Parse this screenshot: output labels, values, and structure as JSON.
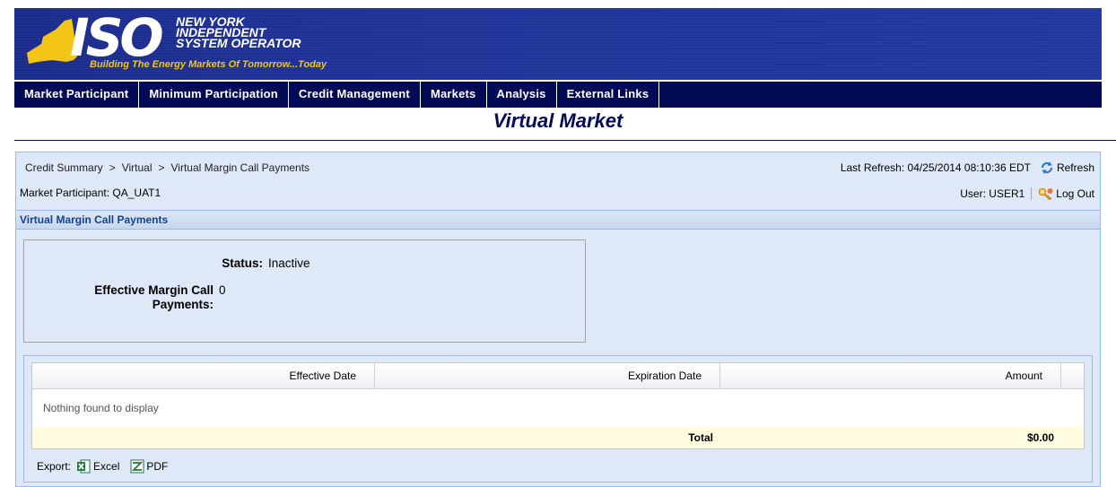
{
  "header": {
    "logo_text": "ISO",
    "org_name_lines": [
      "NEW YORK",
      "INDEPENDENT",
      "SYSTEM OPERATOR"
    ],
    "tagline": "Building The Energy Markets Of Tomorrow...Today",
    "colors": {
      "banner": "#1f3399",
      "nav": "#000a55",
      "tagline": "#f2c517",
      "state_shape": "#f2c517"
    }
  },
  "nav": {
    "items": [
      {
        "label": "Market Participant"
      },
      {
        "label": "Minimum Participation"
      },
      {
        "label": "Credit Management"
      },
      {
        "label": "Markets"
      },
      {
        "label": "Analysis"
      },
      {
        "label": "External Links"
      }
    ]
  },
  "page": {
    "title": "Virtual Market"
  },
  "breadcrumb": {
    "items": [
      {
        "label": "Credit Summary"
      },
      {
        "label": "Virtual"
      },
      {
        "label": "Virtual Margin Call Payments"
      }
    ],
    "separator": ">"
  },
  "participant": {
    "label": "Market Participant:",
    "value": "QA_UAT1"
  },
  "refresh": {
    "label": "Last Refresh:",
    "timestamp": "04/25/2014 08:10:36 EDT",
    "button_label": "Refresh",
    "icon": "refresh-icon"
  },
  "user": {
    "label": "User:",
    "value": "USER1",
    "logout_label": "Log Out",
    "icon": "logout-key-icon"
  },
  "section": {
    "title": "Virtual Margin Call Payments"
  },
  "status": {
    "status_label": "Status:",
    "status_value": "Inactive",
    "emcp_label_line1": "Effective Margin Call",
    "emcp_label_line2": "Payments:",
    "emcp_value": "0"
  },
  "table": {
    "columns": [
      {
        "label": "Effective Date"
      },
      {
        "label": "Expiration Date"
      },
      {
        "label": "Amount"
      }
    ],
    "empty_message": "Nothing found to display",
    "total_label": "Total",
    "total_value": "$0.00"
  },
  "export": {
    "label": "Export:",
    "excel_label": "Excel",
    "pdf_label": "PDF"
  }
}
